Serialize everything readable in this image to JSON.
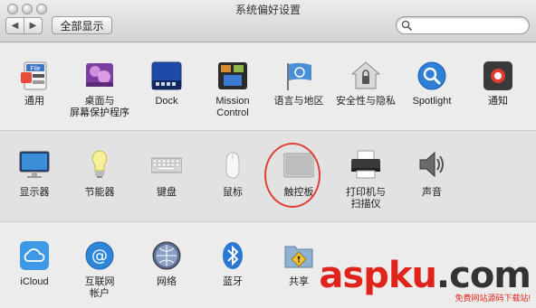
{
  "window": {
    "title": "系统偏好设置"
  },
  "toolbar": {
    "back_glyph": "◀",
    "forward_glyph": "▶",
    "show_all_label": "全部显示",
    "search_value": "",
    "search_placeholder": ""
  },
  "sections": [
    {
      "panes": [
        {
          "label": "通用",
          "icon": "general-icon"
        },
        {
          "label": "桌面与\n屏幕保护程序",
          "icon": "desktop-screensaver-icon"
        },
        {
          "label": "Dock",
          "icon": "dock-icon"
        },
        {
          "label": "Mission\nControl",
          "icon": "mission-control-icon"
        },
        {
          "label": "语言与地区",
          "icon": "language-region-icon"
        },
        {
          "label": "安全性与隐私",
          "icon": "security-privacy-icon"
        },
        {
          "label": "Spotlight",
          "icon": "spotlight-icon"
        },
        {
          "label": "通知",
          "icon": "notifications-icon"
        }
      ]
    },
    {
      "panes": [
        {
          "label": "显示器",
          "icon": "displays-icon"
        },
        {
          "label": "节能器",
          "icon": "energy-saver-icon"
        },
        {
          "label": "键盘",
          "icon": "keyboard-icon"
        },
        {
          "label": "鼠标",
          "icon": "mouse-icon"
        },
        {
          "label": "触控板",
          "icon": "trackpad-icon"
        },
        {
          "label": "打印机与\n扫描仪",
          "icon": "printers-scanners-icon"
        },
        {
          "label": "声音",
          "icon": "sound-icon"
        }
      ]
    },
    {
      "panes": [
        {
          "label": "iCloud",
          "icon": "icloud-icon"
        },
        {
          "label": "互联网\n帐户",
          "icon": "internet-accounts-icon"
        },
        {
          "label": "网络",
          "icon": "network-icon"
        },
        {
          "label": "蓝牙",
          "icon": "bluetooth-icon"
        },
        {
          "label": "共享",
          "icon": "sharing-icon"
        }
      ]
    }
  ],
  "watermark": {
    "brand_a": "asp",
    "brand_dot": "k",
    "brand_b": "u",
    "brand_suffix": ".com",
    "subtitle": "免费网站源码下载站!"
  },
  "colors": {
    "highlight": "#e0403a",
    "watermark": "#e0241b"
  }
}
